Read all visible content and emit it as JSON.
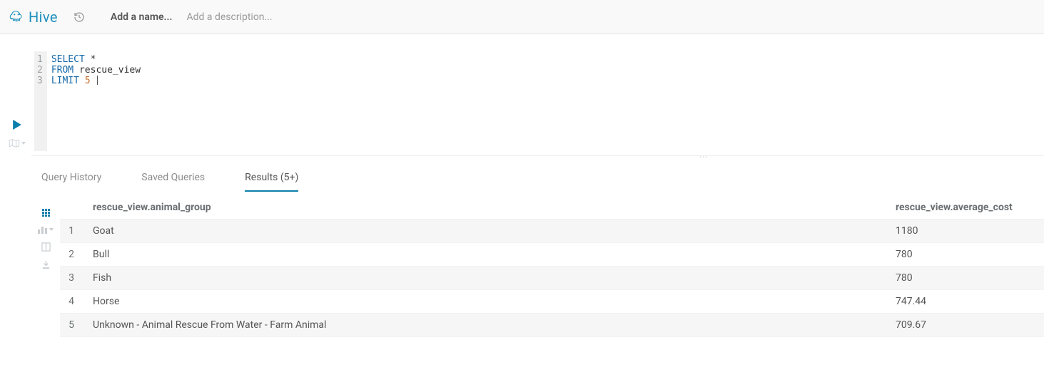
{
  "header": {
    "app_name": "Hive",
    "name_placeholder": "Add a name...",
    "description_placeholder": "Add a description..."
  },
  "editor": {
    "lines": [
      {
        "n": "1",
        "kw1": "SELECT",
        "rest": " *"
      },
      {
        "n": "2",
        "kw1": "FROM",
        "rest": " rescue_view"
      },
      {
        "n": "3",
        "kw1": "LIMIT",
        "num": " 5",
        "rest": " "
      }
    ]
  },
  "tabs": {
    "history": "Query History",
    "saved": "Saved Queries",
    "results": "Results (5+)"
  },
  "results": {
    "columns": {
      "c1": "rescue_view.animal_group",
      "c2": "rescue_view.average_cost"
    },
    "rows": [
      {
        "n": "1",
        "group": "Goat",
        "cost": "1180"
      },
      {
        "n": "2",
        "group": "Bull",
        "cost": "780"
      },
      {
        "n": "3",
        "group": "Fish",
        "cost": "780"
      },
      {
        "n": "4",
        "group": "Horse",
        "cost": "747.44"
      },
      {
        "n": "5",
        "group": "Unknown - Animal Rescue From Water - Farm Animal",
        "cost": "709.67"
      }
    ]
  }
}
